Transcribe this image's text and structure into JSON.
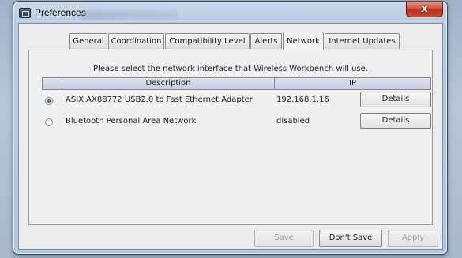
{
  "window": {
    "title": "Preferences",
    "close_glyph": "x"
  },
  "tabs": [
    {
      "label": "General",
      "active": false
    },
    {
      "label": "Coordination",
      "active": false
    },
    {
      "label": "Compatibility Level",
      "active": false
    },
    {
      "label": "Alerts",
      "active": false
    },
    {
      "label": "Network",
      "active": true
    },
    {
      "label": "Internet Updates",
      "active": false
    }
  ],
  "network": {
    "prompt": "Please select the network interface that Wireless Workbench will use.",
    "columns": {
      "description": "Description",
      "ip": "IP"
    },
    "rows": [
      {
        "description": "ASIX AX88772 USB2.0 to Fast Ethernet Adapter",
        "ip": "192.168.1.16",
        "selected": true,
        "button": "Details"
      },
      {
        "description": "Bluetooth Personal Area Network",
        "ip": "disabled",
        "selected": false,
        "button": "Details"
      }
    ]
  },
  "footer": {
    "save_label": "Save",
    "dont_save_label": "Don't Save",
    "apply_label": "Apply"
  },
  "colors": {
    "close_button": "#c9452b",
    "selected_radio": "#1d4fa8"
  }
}
